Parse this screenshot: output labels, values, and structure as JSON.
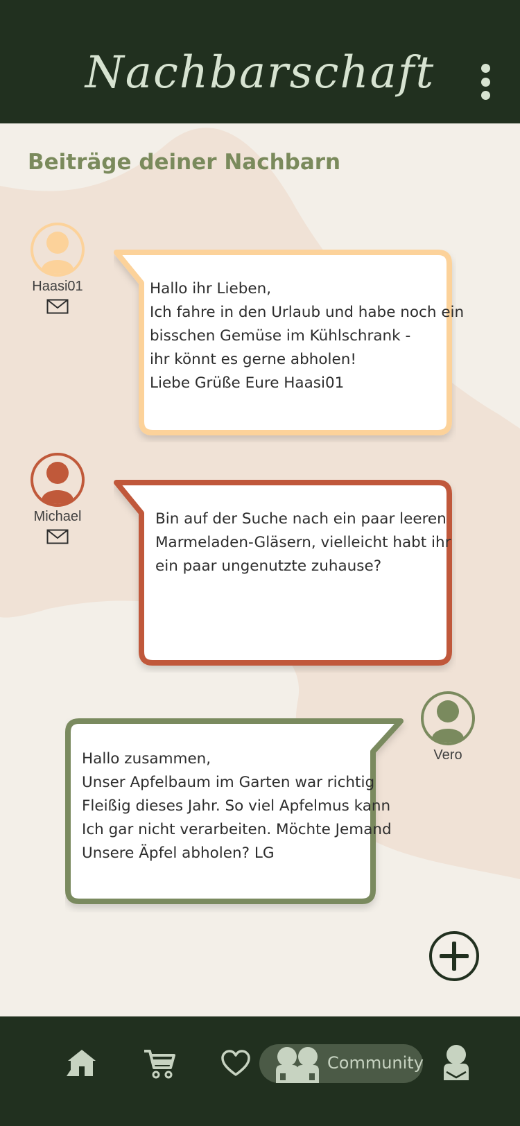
{
  "header": {
    "title": "Nachbarschaft",
    "menu_icon": "more-vertical-icon"
  },
  "main": {
    "section_title": "Beiträge deiner Nachbarn",
    "posts": [
      {
        "author": "Haasi01",
        "accent": "#fcd29a",
        "avatar_icon": "user-avatar-icon",
        "mail_icon": "mail-icon",
        "text": "Hallo ihr Lieben,\nIch fahre in den Urlaub und habe noch ein\nbisschen Gemüse im Kühlschrank -\nihr könnt es gerne abholen!\nLiebe Grüße Eure Haasi01"
      },
      {
        "author": "Michael",
        "accent": "#c0593a",
        "avatar_icon": "user-avatar-icon",
        "mail_icon": "mail-icon",
        "text": "Bin auf der Suche nach ein paar leeren\nMarmeladen-Gläsern, vielleicht habt ihr\nein paar ungenutzte zuhause?"
      },
      {
        "author": "Vero",
        "accent": "#7a8a5e",
        "avatar_icon": "user-avatar-icon",
        "text": "Hallo zusammen,\nUnser Apfelbaum im Garten war richtig\nFleißig dieses Jahr. So viel Apfelmus kann\nIch gar nicht verarbeiten. Möchte Jemand\nUnsere Äpfel abholen? LG"
      }
    ],
    "add_icon": "plus-circle-icon"
  },
  "bottom_nav": {
    "items": [
      {
        "icon": "home-icon"
      },
      {
        "icon": "cart-icon"
      },
      {
        "icon": "heart-icon"
      },
      {
        "icon": "community-icon",
        "label": "Community",
        "active": true
      },
      {
        "icon": "profile-icon"
      }
    ]
  },
  "colors": {
    "dark_green": "#21301f",
    "background": "#f3efe8",
    "blob": "#f0e2d6",
    "title_green": "#7a8a5c",
    "nav_icon": "#c7d3c1"
  }
}
